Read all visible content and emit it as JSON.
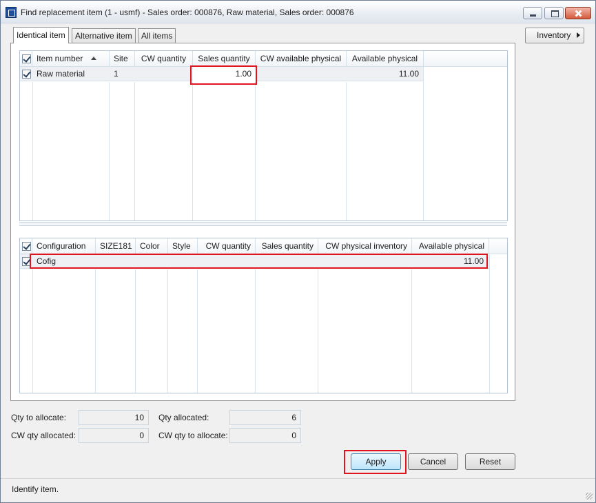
{
  "window": {
    "title": "Find replacement item (1 - usmf) - Sales order: 000876, Raw material, Sales order: 000876"
  },
  "tabs": [
    {
      "label": "Identical item",
      "active": true
    },
    {
      "label": "Alternative item",
      "active": false
    },
    {
      "label": "All items",
      "active": false
    }
  ],
  "inventory_button": {
    "label": "Inventory"
  },
  "item_grid": {
    "columns": [
      "Item number",
      "Site",
      "CW quantity",
      "Sales quantity",
      "CW available physical",
      "Available physical"
    ],
    "rows": [
      {
        "item_number": "Raw material",
        "site": "1",
        "cw_quantity": "",
        "sales_quantity": "1.00",
        "cw_available_physical": "",
        "available_physical": "11.00"
      }
    ]
  },
  "config_grid": {
    "columns": [
      "Configuration",
      "SIZE181",
      "Color",
      "Style",
      "CW quantity",
      "Sales quantity",
      "CW physical inventory",
      "Available physical"
    ],
    "rows": [
      {
        "configuration": "Cofig",
        "size": "",
        "color": "",
        "style": "",
        "cw_quantity": "",
        "sales_quantity": "",
        "cw_physical_inventory": "",
        "available_physical": "11.00"
      }
    ]
  },
  "fields": {
    "qty_to_allocate": {
      "label": "Qty to allocate:",
      "value": "10"
    },
    "qty_allocated": {
      "label": "Qty allocated:",
      "value": "6"
    },
    "cw_qty_allocated": {
      "label": "CW qty allocated:",
      "value": "0"
    },
    "cw_qty_to_allocate": {
      "label": "CW qty to allocate:",
      "value": "0"
    }
  },
  "buttons": {
    "apply": "Apply",
    "cancel": "Cancel",
    "reset": "Reset"
  },
  "status": {
    "text": "Identify item."
  },
  "colors": {
    "highlight": "#e0141e",
    "primary_button": "#bee6fd"
  }
}
